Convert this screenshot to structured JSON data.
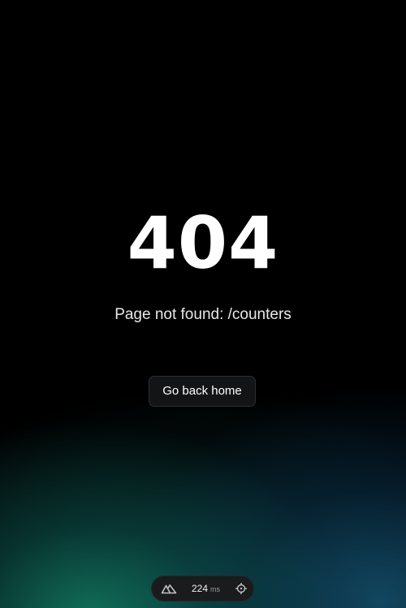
{
  "error": {
    "code": "404",
    "message": "Page not found: /counters"
  },
  "actions": {
    "home_label": "Go back home"
  },
  "devtools": {
    "logo_icon": "nuxt-icon",
    "render_time": "224",
    "render_unit": "ms",
    "inspect_icon": "crosshair-icon"
  },
  "colors": {
    "background": "#000000",
    "glow_teal": "#148c6e",
    "glow_blue": "#14506e",
    "button_bg": "#141618",
    "button_border": "#2b2f33"
  }
}
